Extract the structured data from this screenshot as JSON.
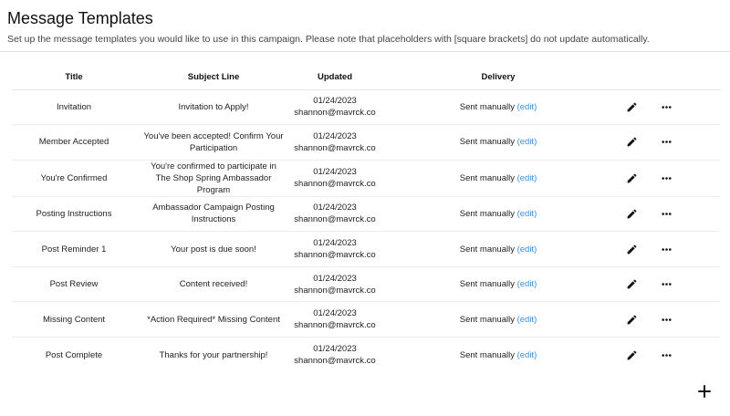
{
  "header": {
    "title": "Message Templates",
    "subtitle": "Set up the message templates you would like to use in this campaign. Please note that placeholders with [square brackets] do not update automatically."
  },
  "table": {
    "columns": [
      "Title",
      "Subject Line",
      "Updated",
      "Delivery"
    ],
    "rows": [
      {
        "title": "Invitation",
        "subject": "Invitation to Apply!",
        "date": "01/24/2023",
        "author": "shannon@mavrck.co",
        "delivery": "Sent manually",
        "edit": "(edit)"
      },
      {
        "title": "Member Accepted",
        "subject": "You've been accepted! Confirm Your Participation",
        "date": "01/24/2023",
        "author": "shannon@mavrck.co",
        "delivery": "Sent manually",
        "edit": "(edit)"
      },
      {
        "title": "You're Confirmed",
        "subject": "You're confirmed to participate in The Shop Spring Ambassador Program",
        "date": "01/24/2023",
        "author": "shannon@mavrck.co",
        "delivery": "Sent manually",
        "edit": "(edit)"
      },
      {
        "title": "Posting Instructions",
        "subject": "Ambassador Campaign Posting Instructions",
        "date": "01/24/2023",
        "author": "shannon@mavrck.co",
        "delivery": "Sent manually",
        "edit": "(edit)"
      },
      {
        "title": "Post Reminder 1",
        "subject": "Your post is due soon!",
        "date": "01/24/2023",
        "author": "shannon@mavrck.co",
        "delivery": "Sent manually",
        "edit": "(edit)"
      },
      {
        "title": "Post Review",
        "subject": "Content received!",
        "date": "01/24/2023",
        "author": "shannon@mavrck.co",
        "delivery": "Sent manually",
        "edit": "(edit)"
      },
      {
        "title": "Missing Content",
        "subject": "*Action Required* Missing Content",
        "date": "01/24/2023",
        "author": "shannon@mavrck.co",
        "delivery": "Sent manually",
        "edit": "(edit)"
      },
      {
        "title": "Post Complete",
        "subject": "Thanks for your partnership!",
        "date": "01/24/2023",
        "author": "shannon@mavrck.co",
        "delivery": "Sent manually",
        "edit": "(edit)"
      }
    ],
    "row_icons": [
      "pencil-icon",
      "more-horizontal-icon"
    ]
  },
  "fab": {
    "icon": "plus-icon"
  },
  "colors": {
    "link": "#3b8fd9",
    "text": "#111111",
    "divider": "#e2e2e2"
  }
}
